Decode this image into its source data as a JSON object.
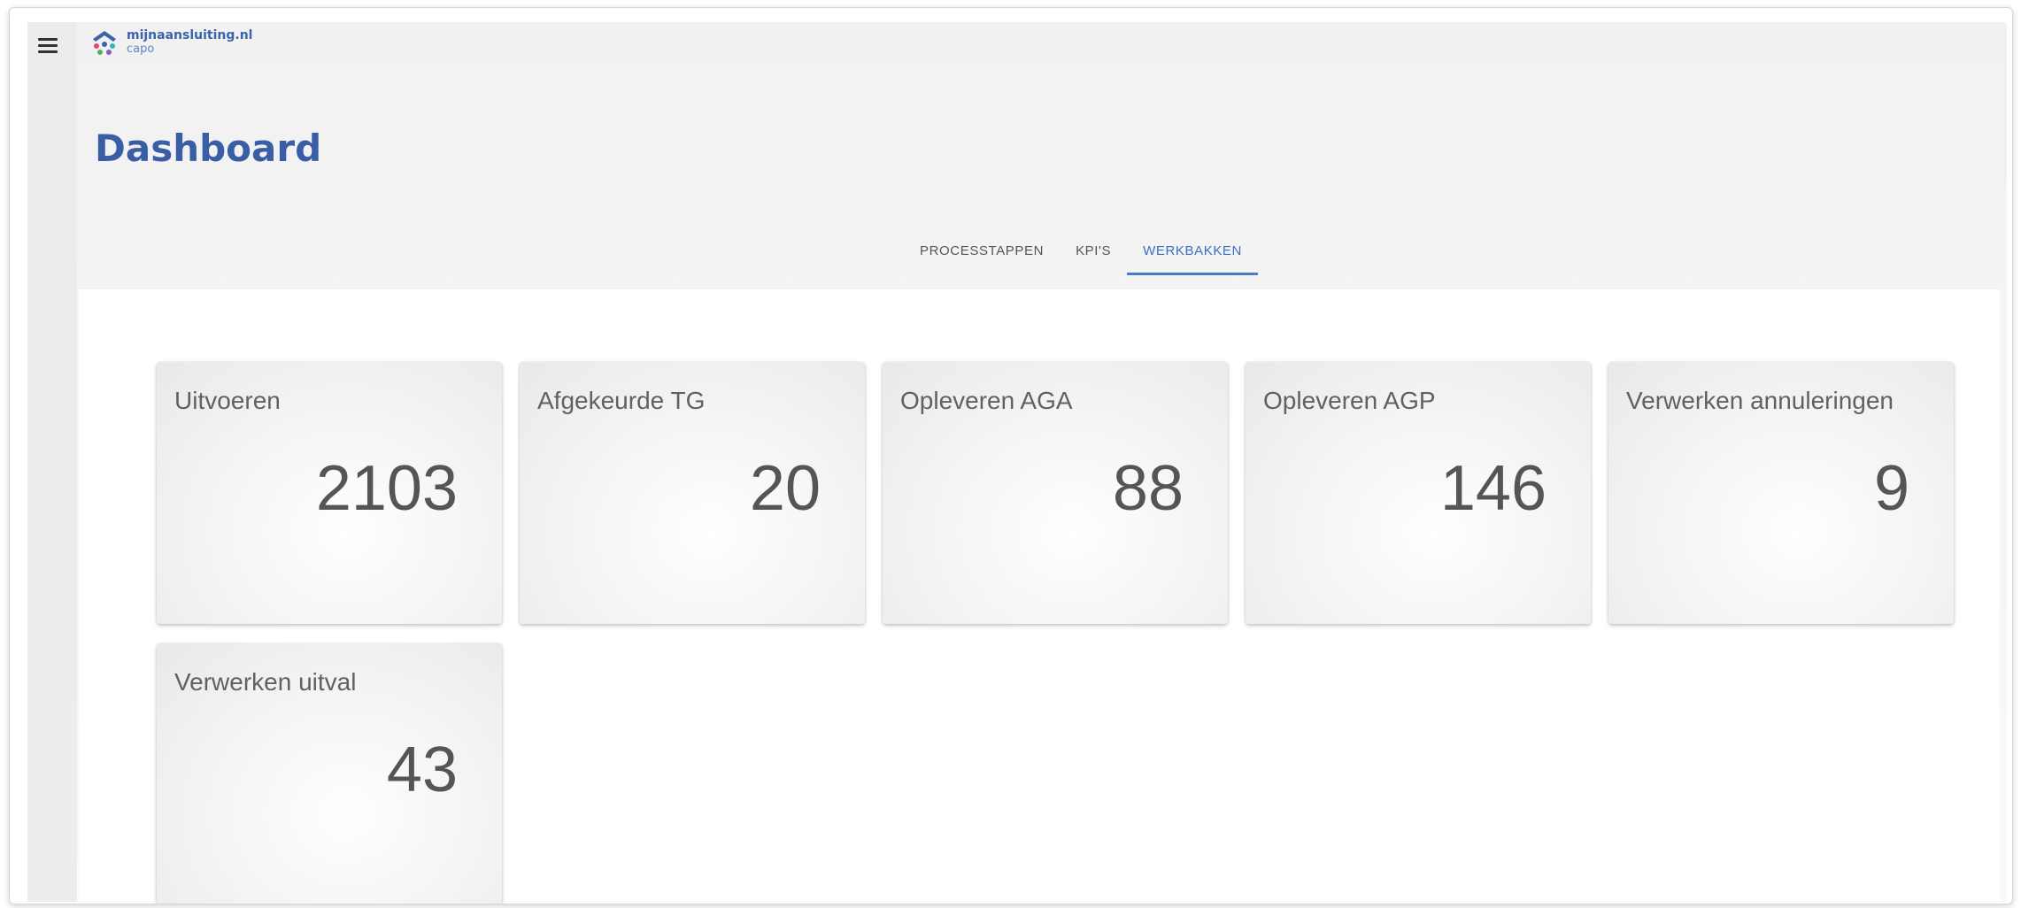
{
  "header": {
    "logo_line1": "mijnaansluiting",
    "logo_line1_suffix": ".nl",
    "logo_line2": "capo"
  },
  "page": {
    "title": "Dashboard"
  },
  "tabs": [
    {
      "label": "PROCESSTAPPEN",
      "active": false
    },
    {
      "label": "KPI'S",
      "active": false
    },
    {
      "label": "WERKBAKKEN",
      "active": true
    }
  ],
  "cards": [
    {
      "label": "Uitvoeren",
      "value": "2103"
    },
    {
      "label": "Afgekeurde TG",
      "value": "20"
    },
    {
      "label": "Opleveren AGA",
      "value": "88"
    },
    {
      "label": "Opleveren AGP",
      "value": "146"
    },
    {
      "label": "Verwerken annuleringen",
      "value": "9"
    },
    {
      "label": "Verwerken uitval",
      "value": "43"
    }
  ],
  "colors": {
    "brand_blue": "#3a5ea6",
    "tab_active": "#3b6ec0",
    "tab_indicator": "#4a7cca",
    "card_text": "#616161"
  },
  "icons": {
    "menu": "hamburger-menu-icon",
    "logo": "house-dots-logo"
  }
}
